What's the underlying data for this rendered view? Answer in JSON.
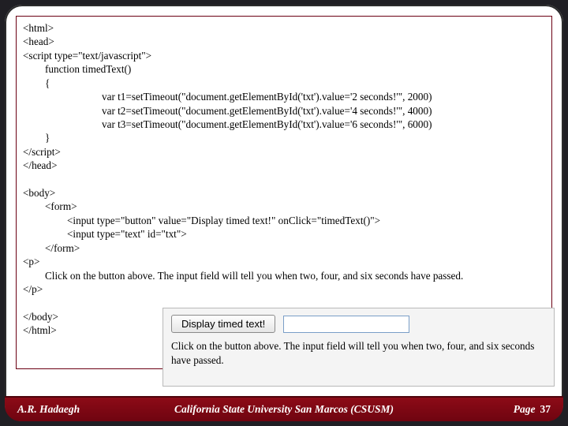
{
  "code": {
    "l1": "<html>",
    "l2": "<head>",
    "l3": "<script type=\"text/javascript\">",
    "l4": "function timedText()",
    "l5": "{",
    "l6": "var t1=setTimeout(\"document.getElementById('txt').value='2 seconds!'\", 2000)",
    "l7": "var t2=setTimeout(\"document.getElementById('txt').value='4 seconds!'\", 4000)",
    "l8": "var t3=setTimeout(\"document.getElementById('txt').value='6 seconds!'\", 6000)",
    "l9": "}",
    "l10": "</script>",
    "l11": "</head>",
    "blank1": " ",
    "l12": "<body>",
    "l13": "<form>",
    "l14": "<input type=\"button\" value=\"Display timed text!\" onClick=\"timedText()\">",
    "l15": "<input type=\"text\" id=\"txt\">",
    "l16": "</form>",
    "l17": "<p>",
    "l18": "Click on the button above. The input field will tell you when two, four, and six seconds have passed.",
    "l19": "</p>",
    "blank2": " ",
    "l20": "</body>",
    "l21": "</html>"
  },
  "preview": {
    "button_label": "Display timed text!",
    "input_value": "",
    "caption": "Click on the button above. The input field will tell you when two, four, and six seconds have passed."
  },
  "footer": {
    "author": "A.R. Hadaegh",
    "institution": "California State University San Marcos (CSUSM)",
    "page_label": "Page",
    "page_number": "37"
  }
}
